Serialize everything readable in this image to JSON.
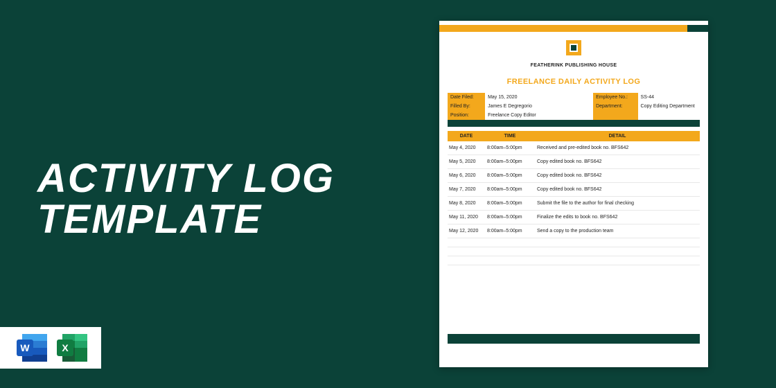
{
  "page_title_line1": "ACTIVITY LOG",
  "page_title_line2": "TEMPLATE",
  "icons": {
    "word": "W",
    "excel": "X"
  },
  "doc": {
    "company": "FEATHERINK PUBLISHING HOUSE",
    "title": "FREELANCE DAILY ACTIVITY LOG",
    "meta": {
      "date_filed_label": "Date Filed:",
      "date_filed_value": "May 15, 2020",
      "employee_no_label": "Employee No.:",
      "employee_no_value": "SS-44",
      "filled_by_label": "Filled By:",
      "filled_by_value": "James E Degregorio",
      "department_label": "Department:",
      "department_value": "Copy Editing Department",
      "position_label": "Position:",
      "position_value": "Freelance Copy Editor"
    },
    "headers": {
      "date": "DATE",
      "time": "TIME",
      "detail": "DETAIL"
    },
    "rows": [
      {
        "date": "May 4, 2020",
        "time": "8:00am–5:00pm",
        "detail": "Received and pre-edited book no. BFS642"
      },
      {
        "date": "May 5, 2020",
        "time": "8:00am–5:00pm",
        "detail": "Copy edited book no. BFS642"
      },
      {
        "date": "May 6, 2020",
        "time": "8:00am–5:00pm",
        "detail": "Copy edited book no. BFS642"
      },
      {
        "date": "May 7, 2020",
        "time": "8:00am–5:00pm",
        "detail": "Copy edited book no. BFS642"
      },
      {
        "date": "May 8, 2020",
        "time": "8:00am–5:00pm",
        "detail": "Submit the file to the author for final checking"
      },
      {
        "date": "May 11, 2020",
        "time": "8:00am–5:00pm",
        "detail": "Finalize the edits to book no. BFS642"
      },
      {
        "date": "May 12, 2020",
        "time": "8:00am–5:00pm",
        "detail": "Send a copy to the production team"
      },
      {
        "date": "",
        "time": "",
        "detail": ""
      },
      {
        "date": "",
        "time": "",
        "detail": ""
      },
      {
        "date": "",
        "time": "",
        "detail": ""
      }
    ]
  }
}
